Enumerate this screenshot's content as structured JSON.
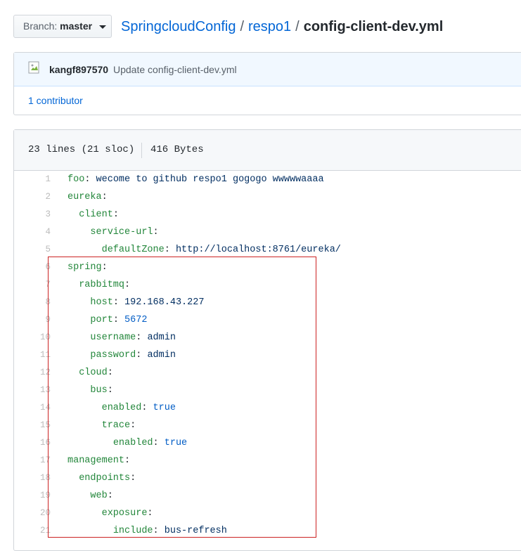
{
  "branch": {
    "label": "Branch:",
    "value": "master"
  },
  "breadcrumb": {
    "repo": "SpringcloudConfig",
    "folder": "respo1",
    "file": "config-client-dev.yml",
    "separator": "/"
  },
  "commit": {
    "author": "kangf897570",
    "message": "Update config-client-dev.yml",
    "contributors": "1 contributor"
  },
  "file": {
    "lines_info": "23 lines (21 sloc)",
    "size": "416 Bytes"
  },
  "code_lines": [
    {
      "num": "1",
      "indent": "",
      "key": "foo",
      "value": "wecome to github respo1 gogogo wwwwwaaaa",
      "value_type": "str"
    },
    {
      "num": "2",
      "indent": "",
      "key": "eureka",
      "value": "",
      "value_type": ""
    },
    {
      "num": "3",
      "indent": "  ",
      "key": "client",
      "value": "",
      "value_type": ""
    },
    {
      "num": "4",
      "indent": "    ",
      "key": "service-url",
      "value": "",
      "value_type": ""
    },
    {
      "num": "5",
      "indent": "      ",
      "key": "defaultZone",
      "value": "http://localhost:8761/eureka/",
      "value_type": "str"
    },
    {
      "num": "6",
      "indent": "",
      "key": "spring",
      "value": "",
      "value_type": ""
    },
    {
      "num": "7",
      "indent": "  ",
      "key": "rabbitmq",
      "value": "",
      "value_type": ""
    },
    {
      "num": "8",
      "indent": "    ",
      "key": "host",
      "value": "192.168.43.227",
      "value_type": "str"
    },
    {
      "num": "9",
      "indent": "    ",
      "key": "port",
      "value": "5672",
      "value_type": "num"
    },
    {
      "num": "10",
      "indent": "    ",
      "key": "username",
      "value": "admin",
      "value_type": "str"
    },
    {
      "num": "11",
      "indent": "    ",
      "key": "password",
      "value": "admin",
      "value_type": "str"
    },
    {
      "num": "12",
      "indent": "  ",
      "key": "cloud",
      "value": "",
      "value_type": ""
    },
    {
      "num": "13",
      "indent": "    ",
      "key": "bus",
      "value": "",
      "value_type": ""
    },
    {
      "num": "14",
      "indent": "      ",
      "key": "enabled",
      "value": "true",
      "value_type": "num"
    },
    {
      "num": "15",
      "indent": "      ",
      "key": "trace",
      "value": "",
      "value_type": ""
    },
    {
      "num": "16",
      "indent": "        ",
      "key": "enabled",
      "value": "true",
      "value_type": "num"
    },
    {
      "num": "17",
      "indent": "",
      "key": "management",
      "value": "",
      "value_type": ""
    },
    {
      "num": "18",
      "indent": "  ",
      "key": "endpoints",
      "value": "",
      "value_type": ""
    },
    {
      "num": "19",
      "indent": "    ",
      "key": "web",
      "value": "",
      "value_type": ""
    },
    {
      "num": "20",
      "indent": "      ",
      "key": "exposure",
      "value": "",
      "value_type": ""
    },
    {
      "num": "21",
      "indent": "        ",
      "key": "include",
      "value": "bus-refresh",
      "value_type": "str"
    }
  ],
  "colors": {
    "link": "#0366d6",
    "key": "#22863a",
    "string": "#032f62",
    "number": "#005cc5",
    "highlight": "#cc2222"
  }
}
